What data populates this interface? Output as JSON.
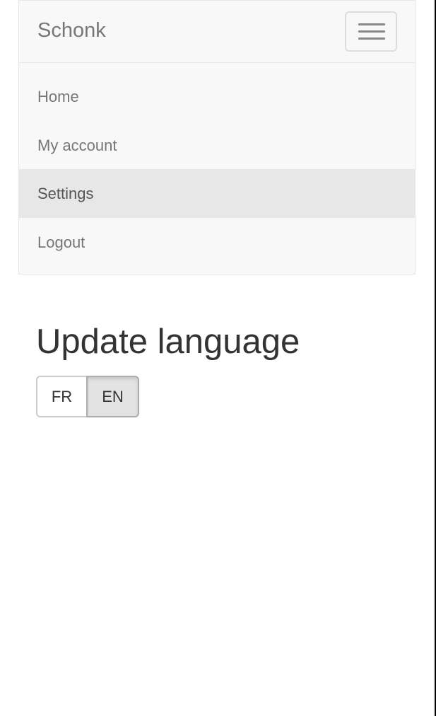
{
  "navbar": {
    "brand": "Schonk",
    "toggle_icon": "hamburger-menu-icon",
    "items": [
      {
        "label": "Home",
        "active": false
      },
      {
        "label": "My account",
        "active": false
      },
      {
        "label": "Settings",
        "active": true
      },
      {
        "label": "Logout",
        "active": false
      }
    ]
  },
  "main": {
    "title": "Update language",
    "languages": [
      {
        "label": "FR",
        "selected": false
      },
      {
        "label": "EN",
        "selected": true
      }
    ]
  },
  "colors": {
    "navbar_bg": "#f8f8f8",
    "active_item_bg": "#e7e7e7",
    "link_text": "#777777",
    "selected_button_bg": "#e3e3e3"
  }
}
